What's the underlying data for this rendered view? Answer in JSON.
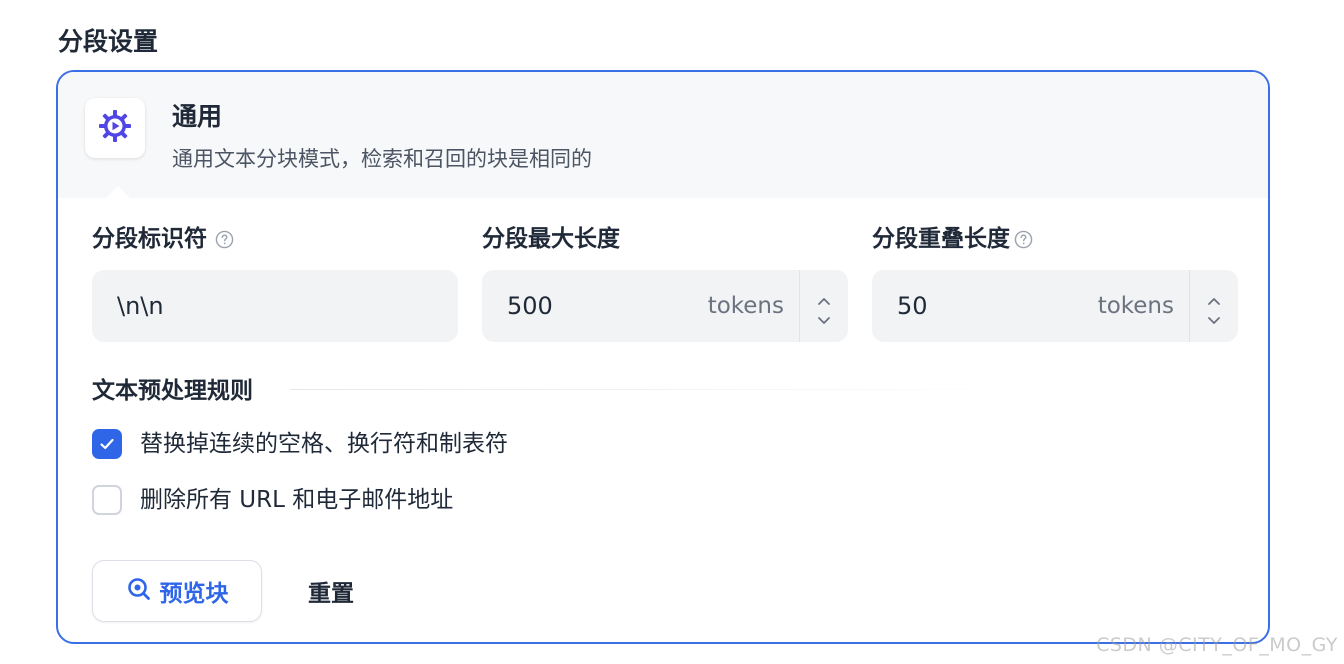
{
  "section_title": "分段设置",
  "mode": {
    "icon": "gear-play-icon",
    "title": "通用",
    "description": "通用文本分块模式，检索和召回的块是相同的"
  },
  "fields": {
    "separator": {
      "label": "分段标识符",
      "help_icon": "question-circle-icon",
      "value": "\\n\\n"
    },
    "max_length": {
      "label": "分段最大长度",
      "value": "500",
      "unit": "tokens"
    },
    "overlap": {
      "label": "分段重叠长度",
      "help_icon": "question-circle-icon",
      "value": "50",
      "unit": "tokens"
    }
  },
  "rules": {
    "title": "文本预处理规则",
    "items": [
      {
        "label": "替换掉连续的空格、换行符和制表符",
        "checked": true
      },
      {
        "label": "删除所有 URL 和电子邮件地址",
        "checked": false
      }
    ]
  },
  "actions": {
    "preview_label": "预览块",
    "preview_icon": "search-icon",
    "reset_label": "重置"
  },
  "colors": {
    "accent": "#2f66e8",
    "card_border": "#3b6fe5",
    "header_bg": "#f7f8fa",
    "input_bg": "#f2f3f5"
  },
  "watermark": "CSDN @CITY_OF_MO_GY"
}
